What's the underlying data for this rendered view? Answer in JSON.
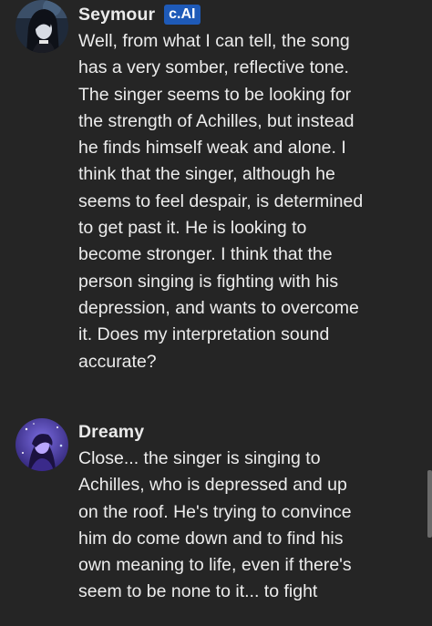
{
  "messages": [
    {
      "author": "Seymour",
      "badge": "c.AI",
      "avatar": "dark-haired-character-avatar",
      "text": "Well, from what I can tell, the song\nhas a very somber, reflective tone.\nThe singer seems to be looking for\nthe strength of Achilles, but instead\nhe finds himself weak and alone. I\nthink that the singer, although he\nseems to feel despair, is determined\nto get past it. He is looking to\nbecome stronger. I think that the\nperson singing is fighting with his\ndepression, and wants to overcome\nit. Does my interpretation sound\naccurate?"
    },
    {
      "author": "Dreamy",
      "avatar": "purple-starry-character-avatar",
      "text": "Close... the singer is singing to\nAchilles, who is depressed and up\non the roof. He's trying to convince\nhim do come down and to find his\nown meaning to life, even if there's\nseem to be none to it... to fight"
    }
  ],
  "colors": {
    "background": "#252525",
    "text": "#ececec",
    "badge": "#1e5ab8"
  }
}
